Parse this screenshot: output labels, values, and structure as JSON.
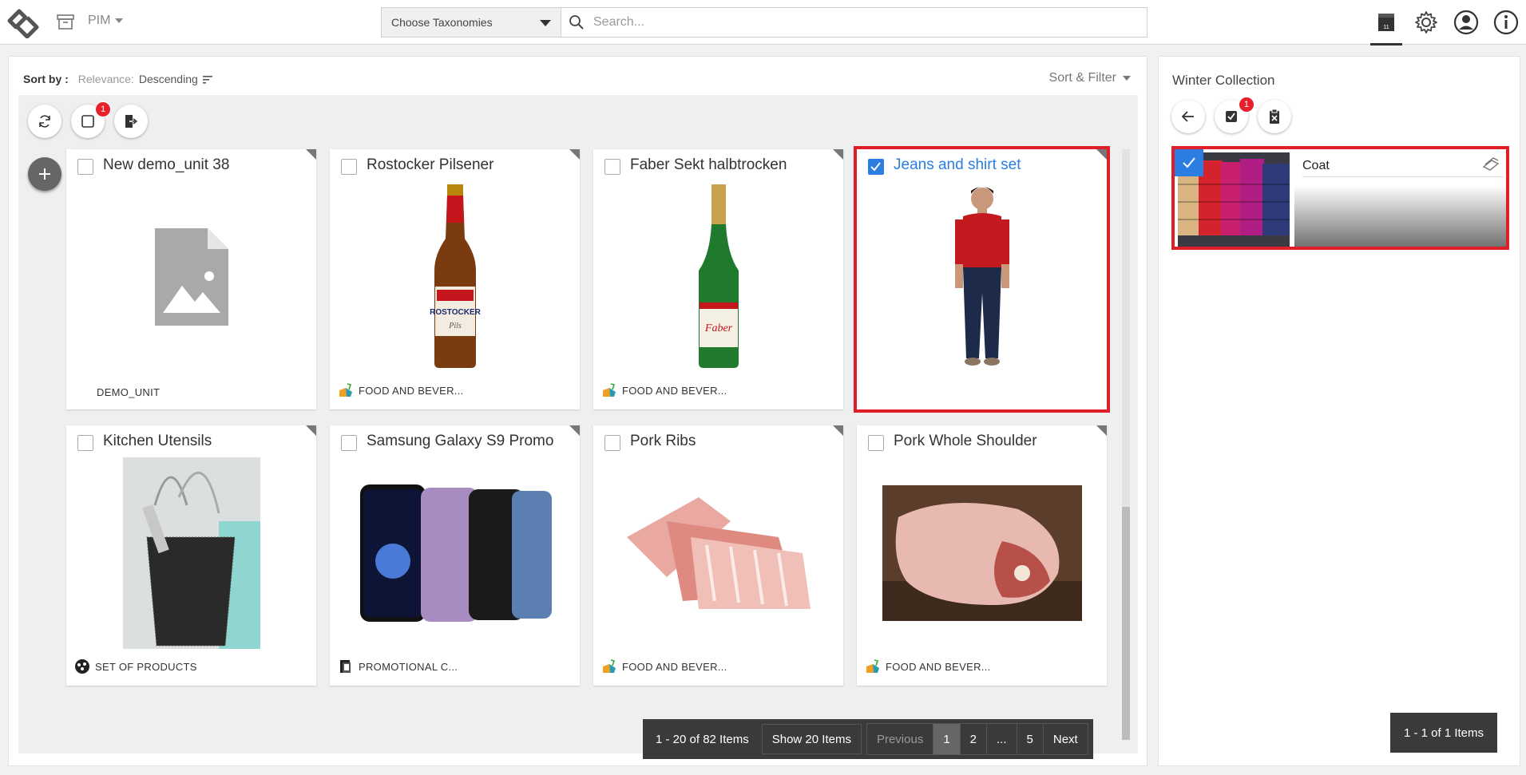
{
  "topbar": {
    "module_label": "PIM",
    "taxonomy_select": "Choose Taxonomies",
    "search_placeholder": "Search..."
  },
  "sort": {
    "label": "Sort by :",
    "field": "Relevance:",
    "direction": "Descending",
    "filter_label": "Sort & Filter"
  },
  "toolbar": {
    "selection_badge": "1"
  },
  "cards": [
    {
      "title": "New demo_unit 38",
      "category": "DEMO_UNIT",
      "selected": false
    },
    {
      "title": "Rostocker Pilsener",
      "category": "FOOD AND BEVER...",
      "selected": false
    },
    {
      "title": "Faber Sekt halbtrocken",
      "category": "FOOD AND BEVER...",
      "selected": false
    },
    {
      "title": "Jeans and shirt set",
      "category": "",
      "selected": true
    },
    {
      "title": "Kitchen Utensils",
      "category": "SET OF PRODUCTS",
      "selected": false
    },
    {
      "title": "Samsung Galaxy S9 Promo",
      "category": "PROMOTIONAL C...",
      "selected": false
    },
    {
      "title": "Pork Ribs",
      "category": "FOOD AND BEVER...",
      "selected": false
    },
    {
      "title": "Pork Whole Shoulder",
      "category": "FOOD AND BEVER...",
      "selected": false
    }
  ],
  "pager": {
    "info": "1 - 20 of 82 Items",
    "show": "Show 20 Items",
    "previous": "Previous",
    "pages": [
      "1",
      "2",
      "...",
      "5"
    ],
    "next": "Next"
  },
  "side": {
    "title": "Winter Collection",
    "badge": "1",
    "item_name": "Coat",
    "count": "1 - 1 of 1 Items"
  },
  "colors": {
    "accent_blue": "#2b7de1",
    "selection_red": "#e01e27",
    "pager_bg": "#3a3a3a"
  }
}
